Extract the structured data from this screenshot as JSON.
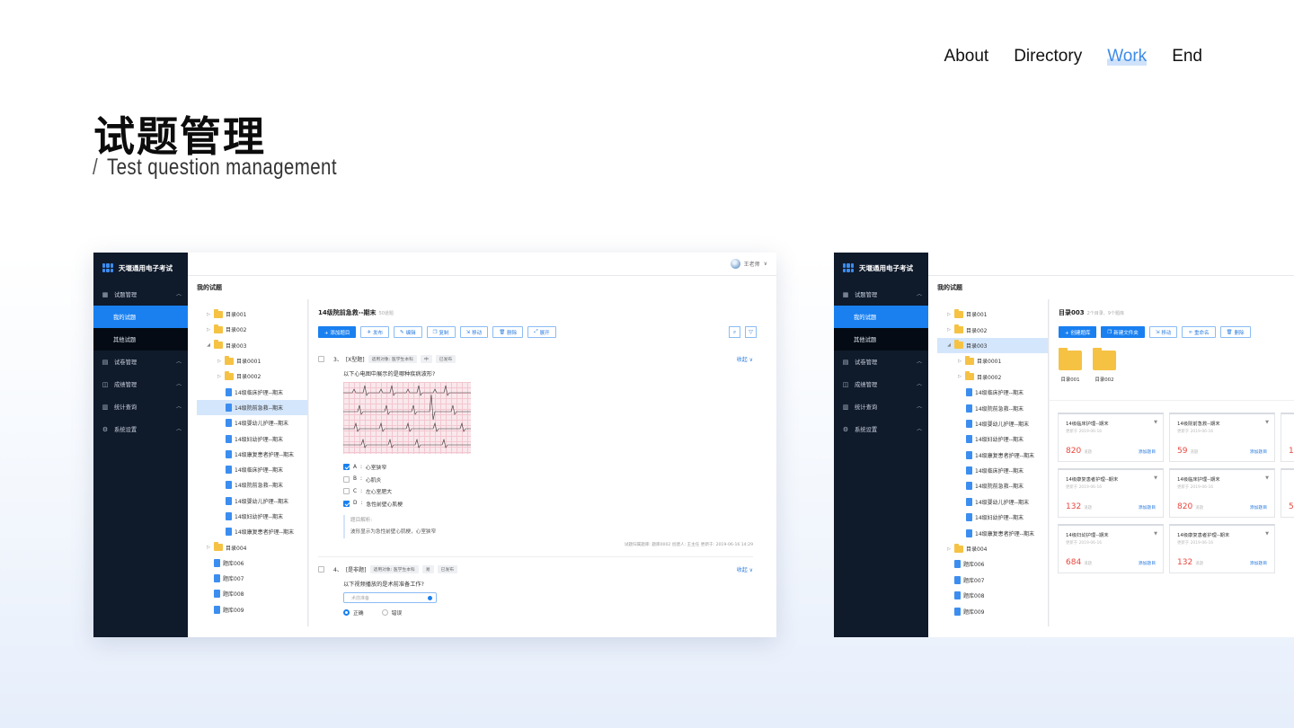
{
  "nav": {
    "about": "About",
    "directory": "Directory",
    "work": "Work",
    "end": "End"
  },
  "hero": {
    "title": "试题管理",
    "slash": "/",
    "subtitle": "Test question management"
  },
  "app": {
    "name": "天堰通用电子考试",
    "user": "王老师",
    "breadcrumb": "我的试题",
    "menu": {
      "exam_questions": "试题管理",
      "my_questions": "我的试题",
      "other_questions": "其他试题",
      "papers": "试卷管理",
      "scores": "成绩管理",
      "stats": "统计查询",
      "settings": "系统设置"
    }
  },
  "shot1": {
    "tree": [
      "目录001",
      "目录002",
      "目录003",
      "目录0001",
      "目录0002",
      "14级临床护理--期末",
      "14级院前急救--期末",
      "14级婴幼儿护理--期末",
      "14级妇幼护理--期末",
      "14级康复患者护理--期末",
      "14级临床护理--期末",
      "14级院前急救--期末",
      "14级婴幼儿护理--期末",
      "14级妇幼护理--期末",
      "14级康复患者护理--期末",
      "目录004",
      "题库006",
      "题库007",
      "题库008",
      "题库009"
    ],
    "panel_title": "14级院前急救--期末",
    "panel_count": "50道题",
    "toolbar": {
      "add": "+ 添加题目",
      "publish": "发布",
      "edit": "编辑",
      "copy": "复制",
      "move": "移动",
      "delete": "删除",
      "expand": "展开"
    },
    "q1": {
      "num": "3、",
      "type": "[X型题]",
      "tag_target": "适用对象: 医学生本科",
      "tag_level": "中",
      "tag_status": "已发布",
      "collapse": "收起 ∨",
      "text": "以下心电图中展示的是哪种疾病波形?",
      "options": [
        {
          "key": "A",
          "text": "心室狭窄",
          "checked": true
        },
        {
          "key": "B",
          "text": "心肌炎",
          "checked": false
        },
        {
          "key": "C",
          "text": "左心室肥大",
          "checked": false
        },
        {
          "key": "D",
          "text": "急性前壁心肌梗",
          "checked": true
        }
      ],
      "analysis_label": "题目解析:",
      "analysis_text": "波形显示为急性前壁心肌梗，心室狭窄",
      "meta": "试题归属题库: 题库0002    创建人: 王主任    更新于: 2019-06-16  14:29"
    },
    "q2": {
      "num": "4、",
      "type": "[是非题]",
      "tag_target": "适用对象: 医学生本科",
      "tag_level": "易",
      "tag_status": "已发布",
      "collapse": "收起 ∨",
      "text": "以下视频播放的是术前准备工作?",
      "media": "术前准备",
      "true_label": "正确",
      "false_label": "错误"
    }
  },
  "shot2": {
    "tree": [
      "目录001",
      "目录002",
      "目录003",
      "目录0001",
      "目录0002",
      "14级临床护理--期末",
      "14级院前急救--期末",
      "14级婴幼儿护理--期末",
      "14级妇幼护理--期末",
      "14级康复患者护理--期末",
      "14级临床护理--期末",
      "14级院前急救--期末",
      "14级婴幼儿护理--期末",
      "14级妇幼护理--期末",
      "14级康复患者护理--期末",
      "目录004",
      "题库006",
      "题库007",
      "题库008",
      "题库009"
    ],
    "panel_title": "目录003",
    "panel_count": "2个目录、9个题库",
    "toolbar": {
      "create": "+ 创建题库",
      "new_folder": "新建文件夹",
      "move": "移动",
      "rename": "重命名",
      "delete": "删除"
    },
    "folders": [
      "目录001",
      "目录002"
    ],
    "cards": [
      {
        "name": "14级临床护理--期末",
        "date": "更新于 2019-06-16",
        "count": "820",
        "unit": "道题",
        "add": "添加题目"
      },
      {
        "name": "14级院前急救--期末",
        "date": "更新于 2019-06-16",
        "count": "59",
        "unit": "道题",
        "add": "添加题目"
      },
      {
        "name": "14级康复患者护理--期末",
        "date": "更新于 2019-06-16",
        "count": "132",
        "unit": "道题",
        "add": "添加题目"
      },
      {
        "name": "14级临床护理--期末",
        "date": "更新于 2019-06-16",
        "count": "820",
        "unit": "道题",
        "add": "添加题目"
      },
      {
        "name": "14级妇幼护理--期末",
        "date": "更新于 2019-06-16",
        "count": "684",
        "unit": "道题",
        "add": "添加题目"
      },
      {
        "name": "14级康复患者护理--期末",
        "date": "更新于 2019-06-16",
        "count": "132",
        "unit": "道题",
        "add": "添加题目"
      }
    ],
    "partial_counts": [
      "12",
      "59"
    ]
  }
}
